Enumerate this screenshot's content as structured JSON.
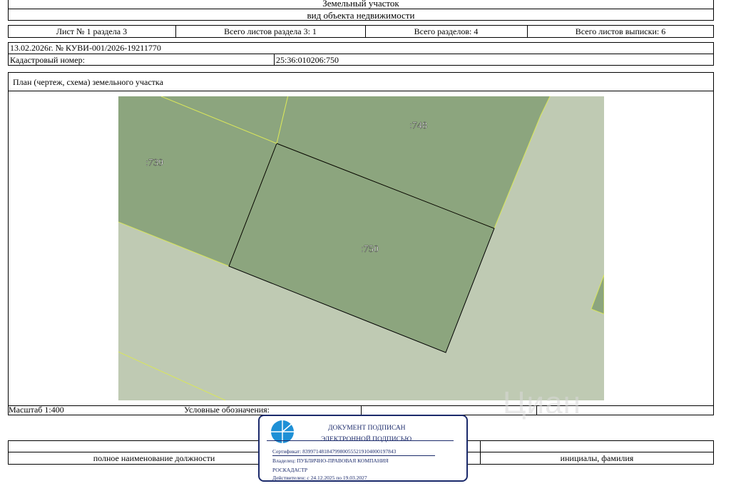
{
  "header": {
    "title": "Земельный участок",
    "subtitle": "вид объекта недвижимости"
  },
  "sheet_info": {
    "sheet": "Лист № 1 раздела 3",
    "total_sheets_section": "Всего листов раздела 3: 1",
    "total_sections": "Всего разделов: 4",
    "total_sheets_extract": "Всего листов выписки: 6"
  },
  "doc_ref": "13.02.2026г. № КУВИ-001/2026-19211770",
  "cadastral": {
    "label": "Кадастровый номер:",
    "value": "25:36:010206:750"
  },
  "plan": {
    "title": "План (чертеж, схема) земельного участка",
    "parcels": [
      ":739",
      ":748",
      ":750"
    ],
    "colors": {
      "parcel_fill": "#8ca57e",
      "background_fill": "#bfcab3",
      "parcel_edge": "#d9e65b",
      "selected_edge": "#000000"
    }
  },
  "footer": {
    "scale": "Масштаб 1:400",
    "legend_label": "Условные обозначения:",
    "position_label": "полное наименование должности",
    "initials_label": "инициалы, фамилия"
  },
  "signature_stamp": {
    "line1": "ДОКУМЕНТ ПОДПИСАН",
    "line2": "ЭЛЕКТРОННОЙ ПОДПИСЬЮ",
    "certificate": "Сертификат: 83997148184799800555219104000197843",
    "owner_line1": "Владелец: ПУБЛИЧНО-ПРАВОВАЯ КОМПАНИЯ",
    "owner_line2": "РОСКАДАСТР",
    "validity": "Действителен: с 24.12.2025 по 19.03.2027",
    "logo_color": "#1e90d6"
  },
  "watermark": "Циан"
}
